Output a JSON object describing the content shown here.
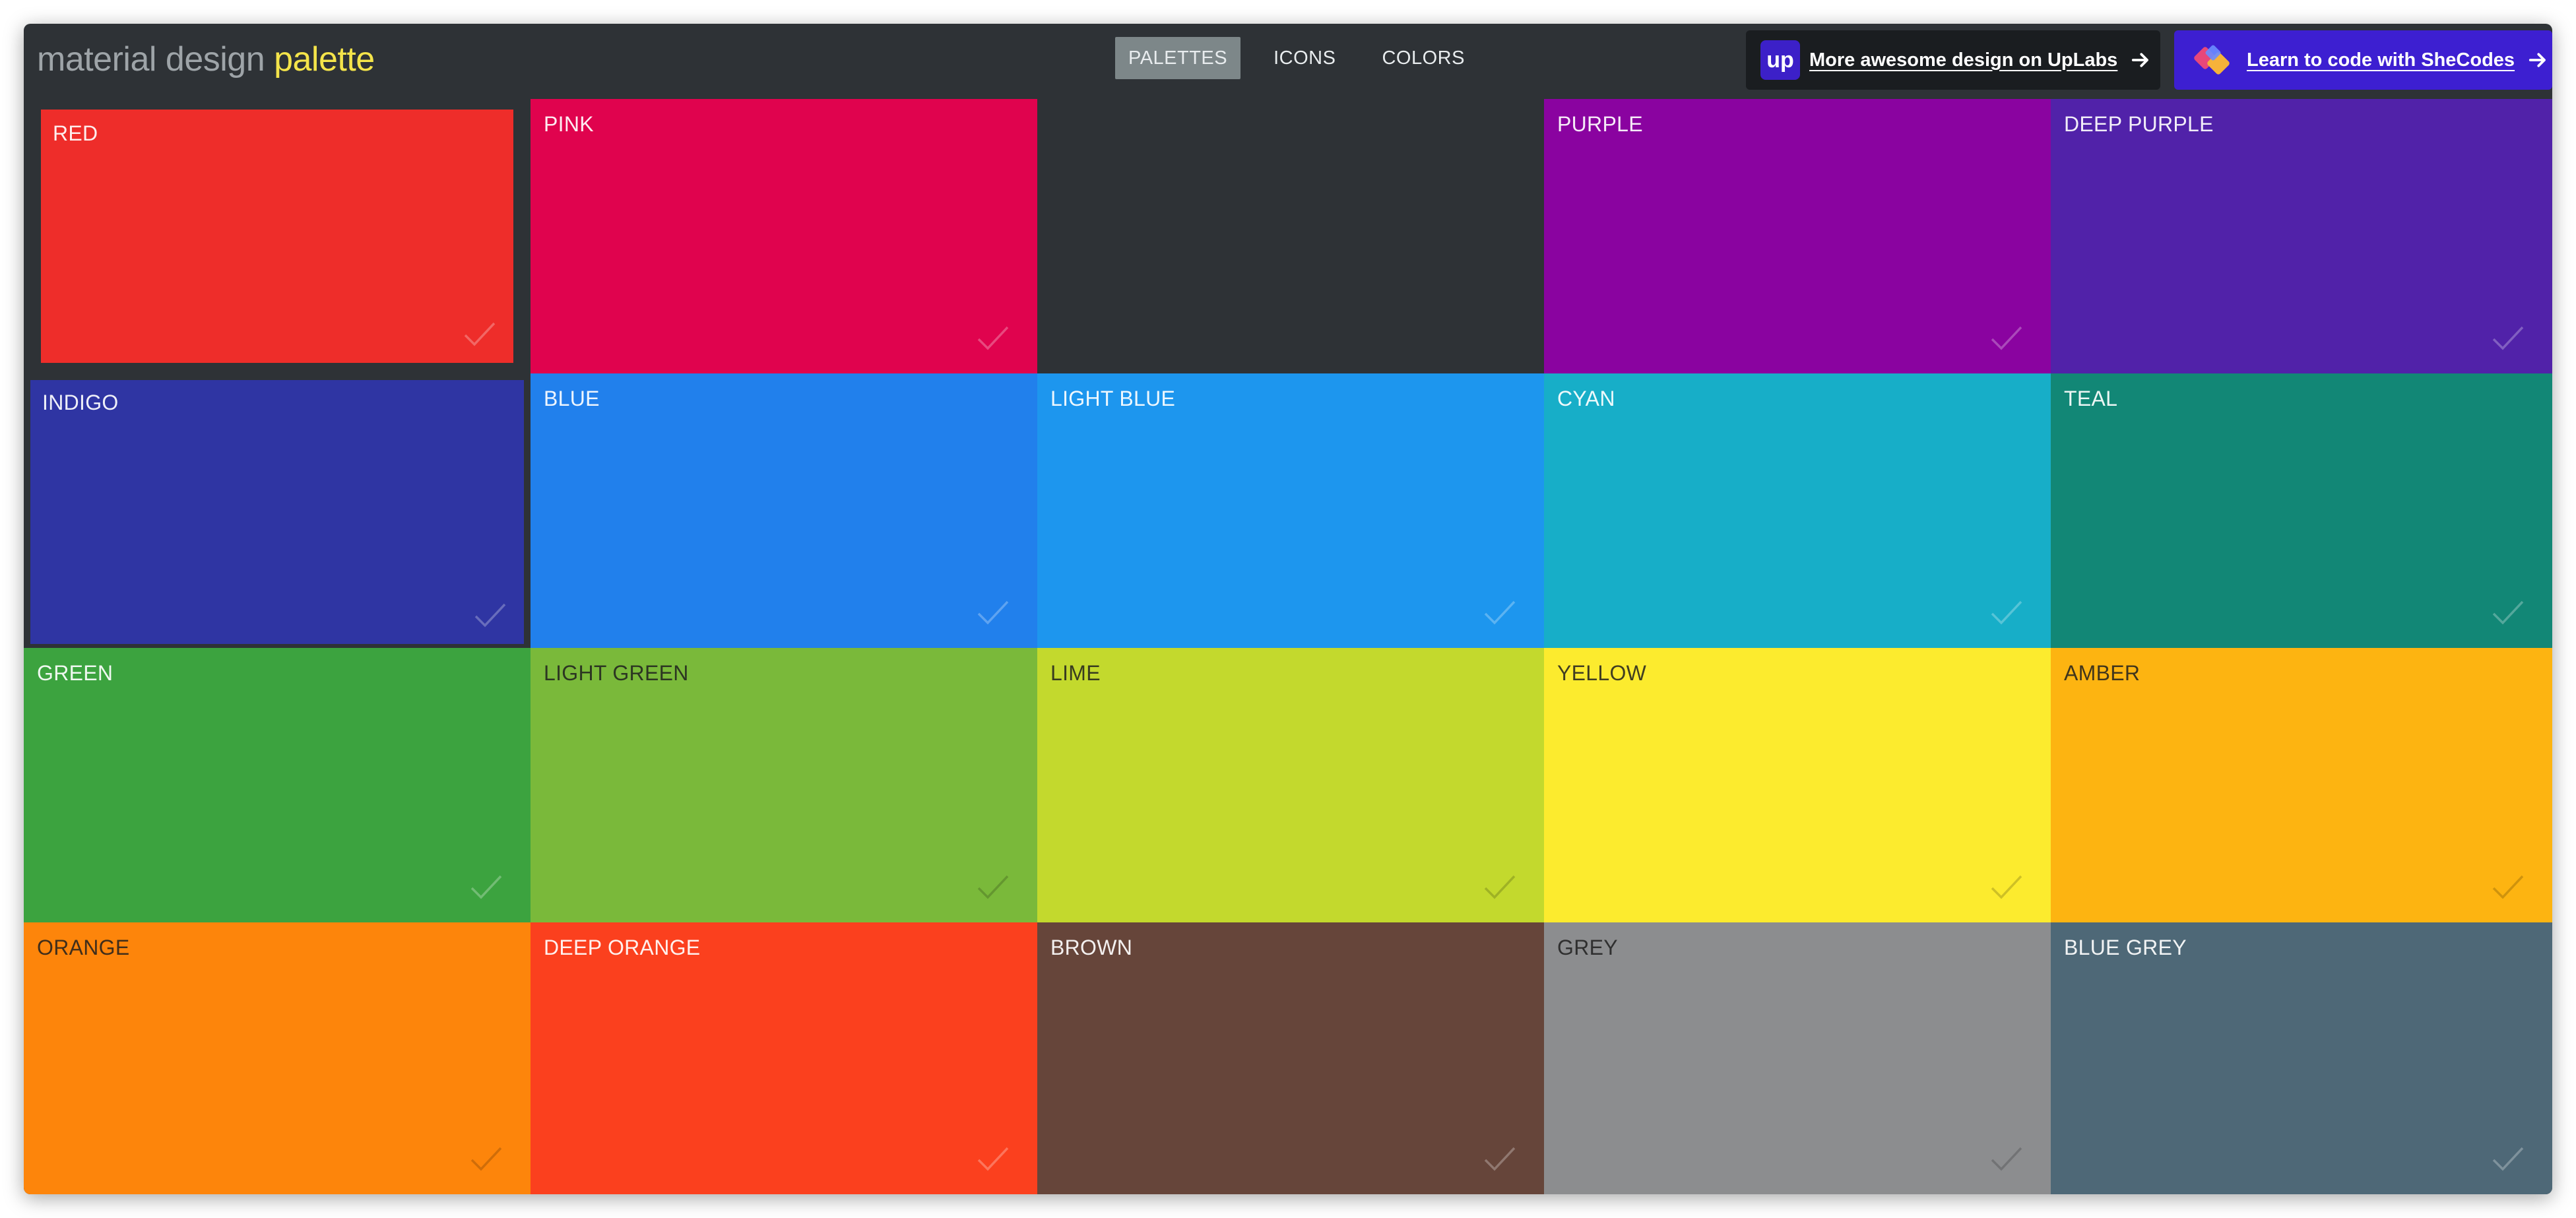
{
  "header": {
    "brand_main": "material design",
    "brand_accent": "palette",
    "nav": [
      "PALETTES",
      "ICONS",
      "COLORS"
    ],
    "promo_uplabs": {
      "badge": "up",
      "text": "More awesome design on UpLabs"
    },
    "promo_shecodes": {
      "text": "Learn to code with SheCodes"
    }
  },
  "colors": {
    "background": "#2e3236",
    "brand_accent": "#f4e44a",
    "uplabs_bg": "#1a1d20",
    "shecodes_bg": "#3d1fd1"
  },
  "tiles": [
    {
      "label": "RED",
      "color": "#ee2d2a"
    },
    {
      "label": "PINK",
      "color": "#e0034e"
    },
    {
      "label": "",
      "color": "#2e3236"
    },
    {
      "label": "PURPLE",
      "color": "#8a03a0"
    },
    {
      "label": "DEEP PURPLE",
      "color": "#5122a9"
    },
    {
      "label": "INDIGO",
      "color": "#2f35a3"
    },
    {
      "label": "BLUE",
      "color": "#2180ec"
    },
    {
      "label": "LIGHT BLUE",
      "color": "#1d96ee"
    },
    {
      "label": "CYAN",
      "color": "#17aec8"
    },
    {
      "label": "TEAL",
      "color": "#128776"
    },
    {
      "label": "GREEN",
      "color": "#3ca33f"
    },
    {
      "label": "LIGHT GREEN",
      "color": "#7ab93a"
    },
    {
      "label": "LIME",
      "color": "#c3d92d"
    },
    {
      "label": "YELLOW",
      "color": "#fceb2e"
    },
    {
      "label": "AMBER",
      "color": "#fdb411"
    },
    {
      "label": "ORANGE",
      "color": "#fd850b"
    },
    {
      "label": "DEEP ORANGE",
      "color": "#fb401e"
    },
    {
      "label": "BROWN",
      "color": "#66453a"
    },
    {
      "label": "GREY",
      "color": "#8c8d8f"
    },
    {
      "label": "BLUE GREY",
      "color": "#4e6877"
    }
  ]
}
